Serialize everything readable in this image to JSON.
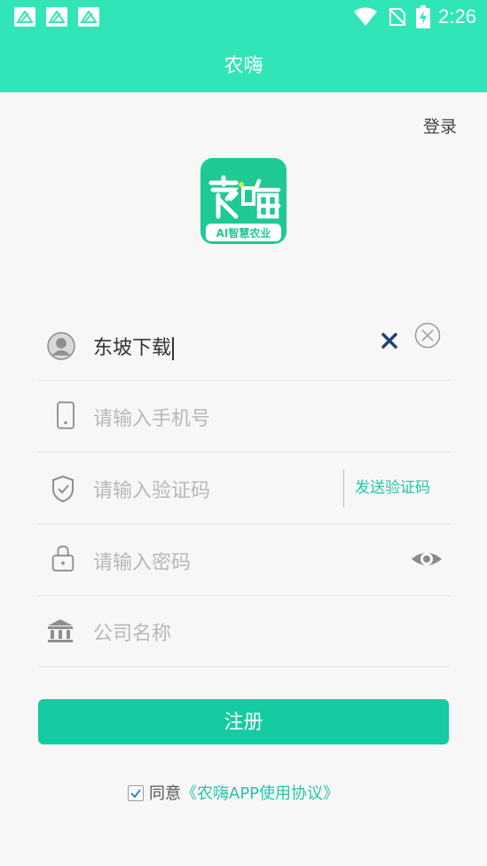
{
  "status_bar": {
    "time": "2:26",
    "notification_icons": [
      "app-notification-icon",
      "app-notification-icon",
      "app-notification-icon"
    ],
    "system_icons": [
      "wifi-icon",
      "no-sim-icon",
      "battery-charging-icon"
    ]
  },
  "header": {
    "title": "农嗨"
  },
  "login_link": "登录",
  "logo": {
    "main_text": "农嗨",
    "tagline": "AI智慧农业"
  },
  "form": {
    "username": {
      "value": "东坡下载",
      "icon": "user-icon"
    },
    "phone": {
      "placeholder": "请输入手机号",
      "icon": "phone-icon"
    },
    "code": {
      "placeholder": "请输入验证码",
      "send_label": "发送验证码",
      "icon": "shield-icon"
    },
    "password": {
      "placeholder": "请输入密码",
      "icon": "lock-icon",
      "toggle_icon": "eye-icon"
    },
    "company": {
      "placeholder": "公司名称",
      "icon": "bank-icon"
    }
  },
  "register_button": "注册",
  "agreement": {
    "prefix": "同意",
    "link": "《农嗨APP使用协议》",
    "checked": true
  },
  "colors": {
    "accent": "#30e6b8",
    "button": "#14cba2",
    "link": "#22c7a8"
  }
}
